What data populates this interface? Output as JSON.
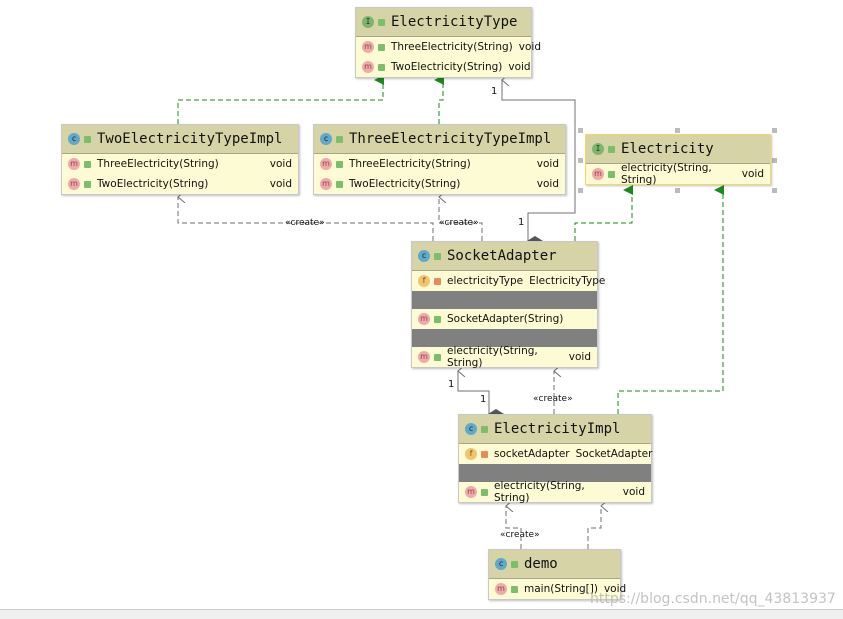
{
  "classes": {
    "electricityType": {
      "name": "ElectricityType",
      "kind": "interface",
      "methods": [
        {
          "name": "ThreeElectricity(String)",
          "type": "void"
        },
        {
          "name": "TwoElectricity(String)",
          "type": "void"
        }
      ]
    },
    "twoImpl": {
      "name": "TwoElectricityTypeImpl",
      "kind": "class",
      "methods": [
        {
          "name": "ThreeElectricity(String)",
          "type": "void"
        },
        {
          "name": "TwoElectricity(String)",
          "type": "void"
        }
      ]
    },
    "threeImpl": {
      "name": "ThreeElectricityTypeImpl",
      "kind": "class",
      "methods": [
        {
          "name": "ThreeElectricity(String)",
          "type": "void"
        },
        {
          "name": "TwoElectricity(String)",
          "type": "void"
        }
      ]
    },
    "electricity": {
      "name": "Electricity",
      "kind": "interface",
      "methods": [
        {
          "name": "electricity(String, String)",
          "type": "void"
        }
      ]
    },
    "socketAdapter": {
      "name": "SocketAdapter",
      "kind": "class",
      "fields": [
        {
          "name": "electricityType",
          "type": "ElectricityType"
        }
      ],
      "constructors": [
        {
          "name": "SocketAdapter(String)"
        }
      ],
      "methods": [
        {
          "name": "electricity(String, String)",
          "type": "void"
        }
      ]
    },
    "electricityImpl": {
      "name": "ElectricityImpl",
      "kind": "class",
      "fields": [
        {
          "name": "socketAdapter",
          "type": "SocketAdapter"
        }
      ],
      "methods": [
        {
          "name": "electricity(String, String)",
          "type": "void"
        }
      ]
    },
    "demo": {
      "name": "demo",
      "kind": "class",
      "methods": [
        {
          "name": "main(String[])",
          "type": "void"
        }
      ]
    }
  },
  "labels": {
    "create": "«create»",
    "one": "1"
  },
  "icons": {
    "interface": "I",
    "class": "c",
    "method": "m",
    "field": "f"
  },
  "colors": {
    "realization": "#1a8a1a",
    "dependency": "#707070",
    "header": "#d6d4a6",
    "body": "#fdfbd3"
  },
  "watermark": "https://blog.csdn.net/qq_43813937"
}
